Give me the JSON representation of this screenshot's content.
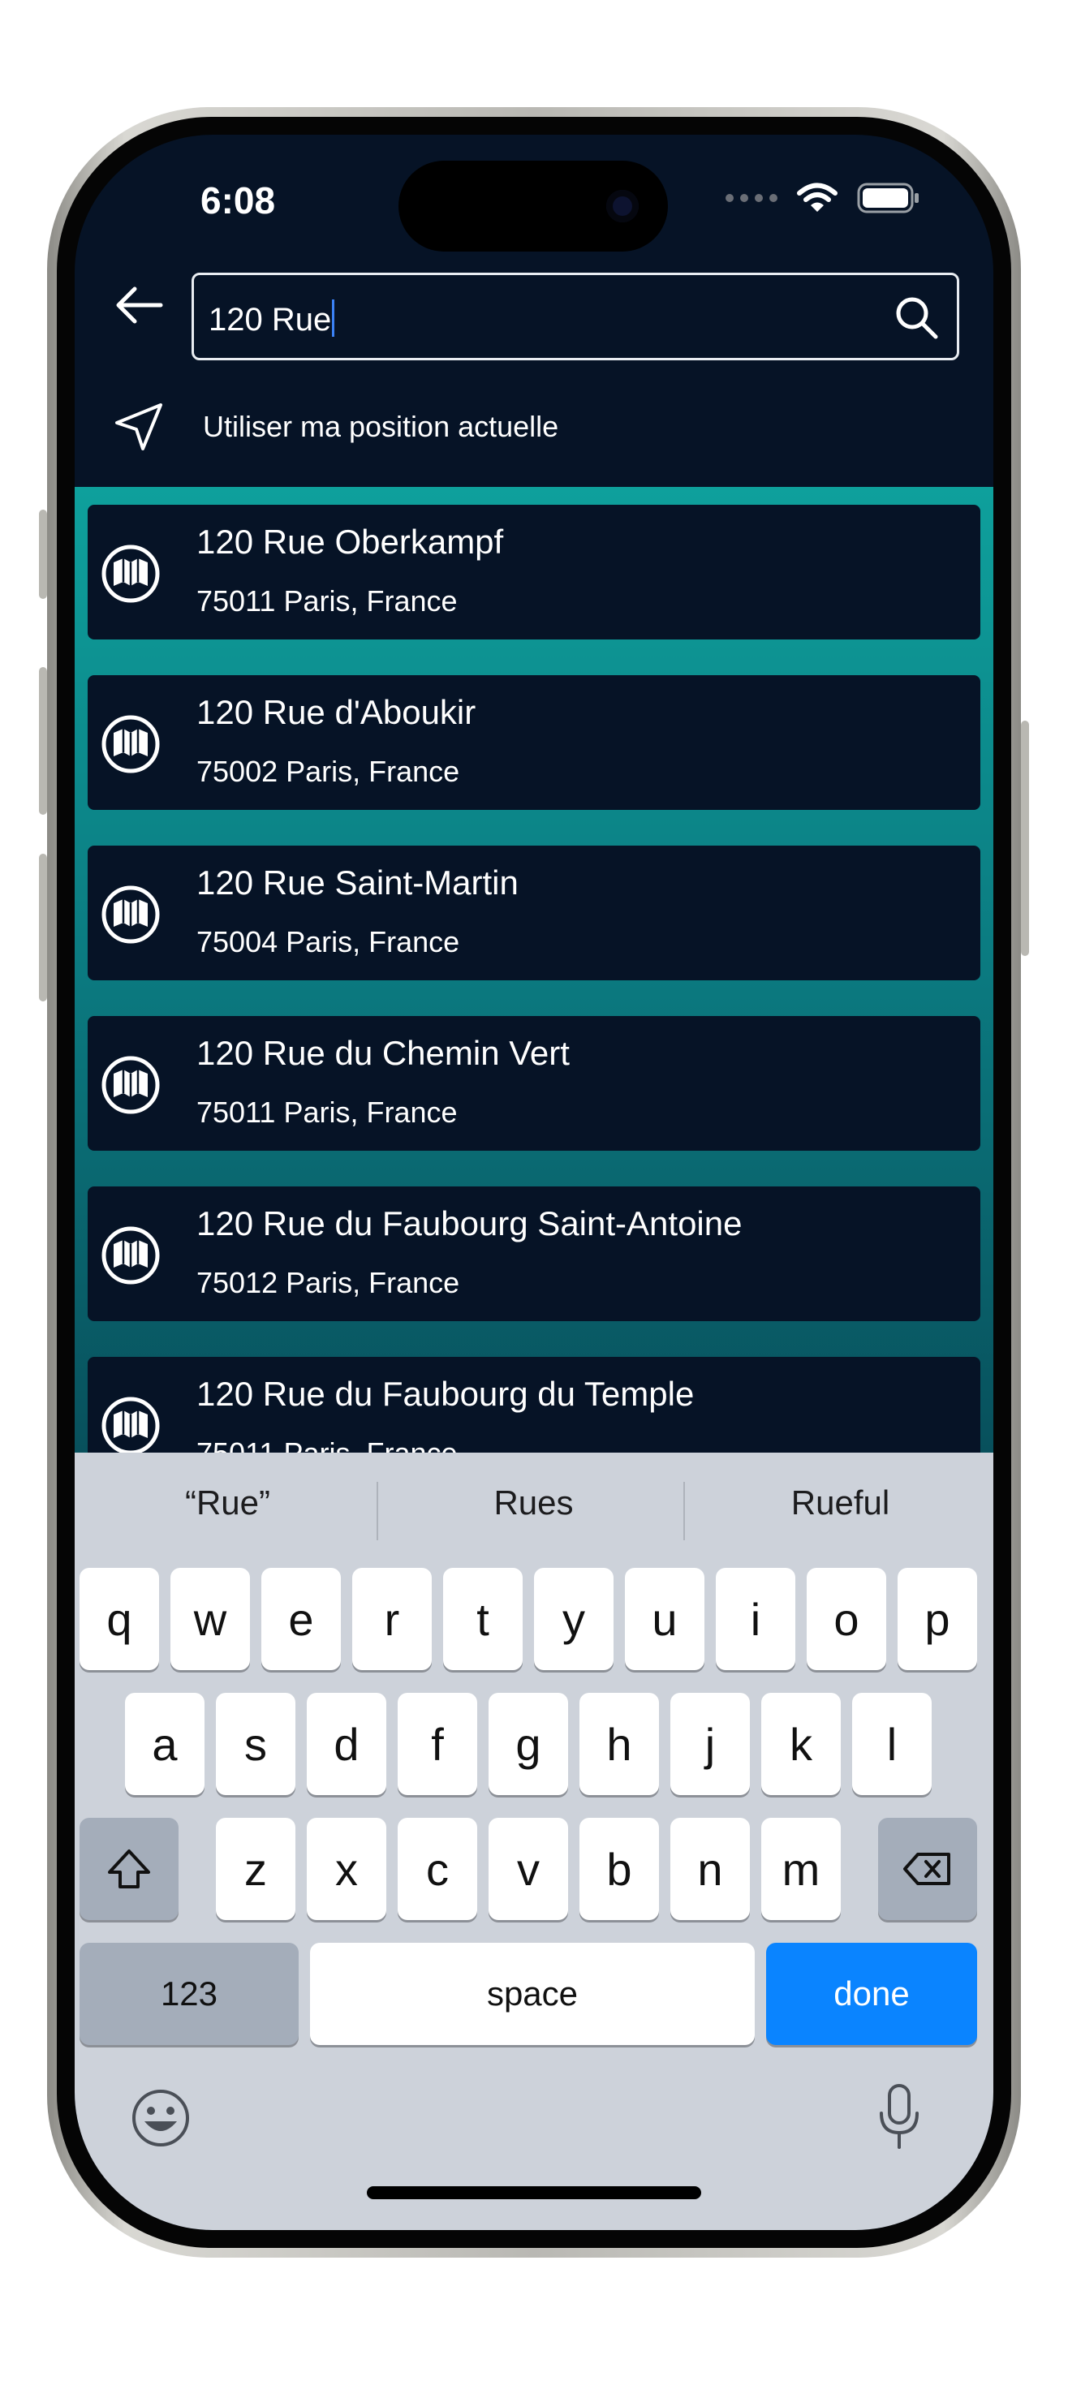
{
  "status": {
    "time": "6:08"
  },
  "search": {
    "value": "120 Rue"
  },
  "location_option": {
    "label": "Utiliser ma position actuelle"
  },
  "results": [
    {
      "title": "120 Rue Oberkampf",
      "subtitle": "75011 Paris, France"
    },
    {
      "title": "120 Rue d'Aboukir",
      "subtitle": "75002 Paris, France"
    },
    {
      "title": "120 Rue Saint-Martin",
      "subtitle": "75004 Paris, France"
    },
    {
      "title": "120 Rue du Chemin Vert",
      "subtitle": "75011 Paris, France"
    },
    {
      "title": "120 Rue du Faubourg Saint-Antoine",
      "subtitle": "75012 Paris, France"
    },
    {
      "title": "120 Rue du Faubourg du Temple",
      "subtitle": "75011 Paris, France"
    }
  ],
  "keyboard": {
    "suggestions": [
      "“Rue”",
      "Rues",
      "Rueful"
    ],
    "row1": [
      "q",
      "w",
      "e",
      "r",
      "t",
      "y",
      "u",
      "i",
      "o",
      "p"
    ],
    "row2": [
      "a",
      "s",
      "d",
      "f",
      "g",
      "h",
      "j",
      "k",
      "l"
    ],
    "row3": [
      "z",
      "x",
      "c",
      "v",
      "b",
      "n",
      "m"
    ],
    "numbers_label": "123",
    "space_label": "space",
    "done_label": "done"
  },
  "colors": {
    "background": "#061326",
    "teal_top": "#0ea09c",
    "teal_bottom": "#08505c",
    "done_blue": "#0a84ff"
  }
}
